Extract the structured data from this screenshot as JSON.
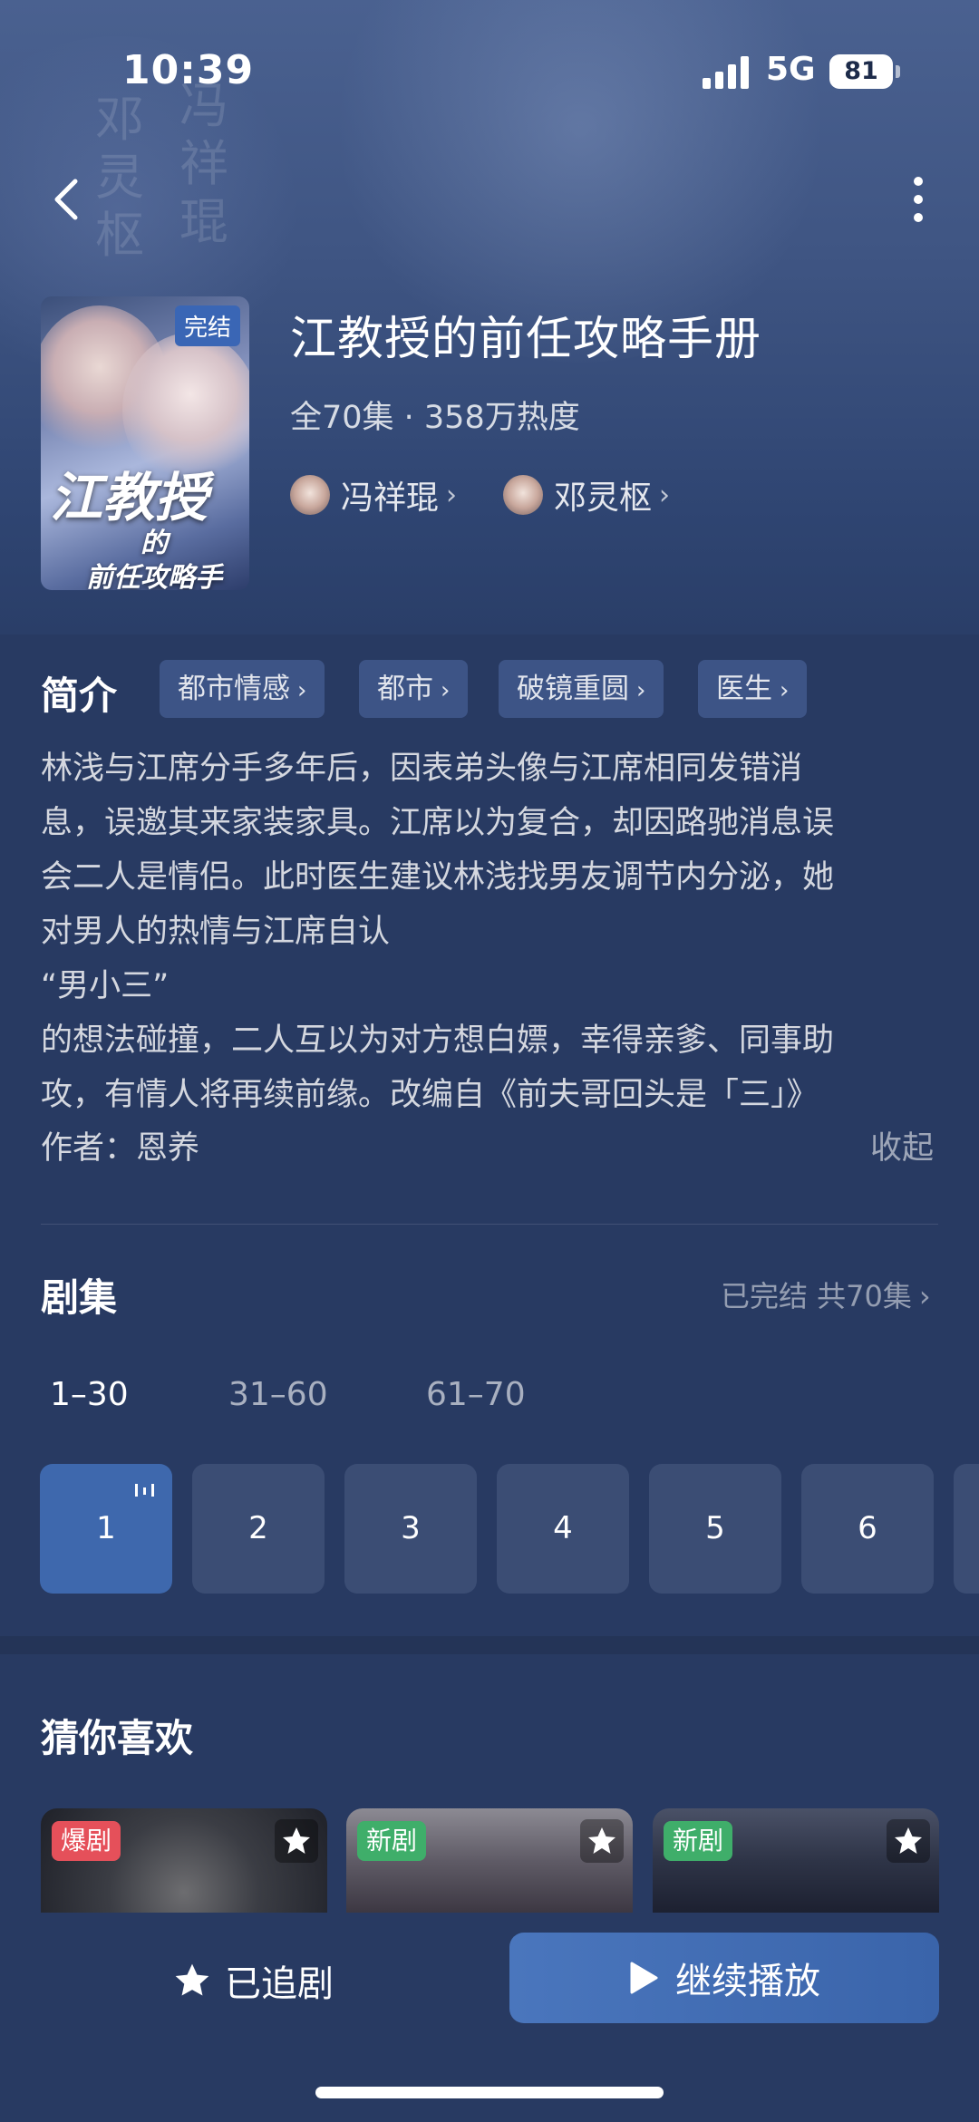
{
  "status_bar": {
    "time": "10:39",
    "network": "5G",
    "battery": "81"
  },
  "poster": {
    "badge": "完结",
    "title_big": "江教授",
    "title_de": "的",
    "title_small": "前任攻略手册"
  },
  "show": {
    "title": "江教授的前任攻略手册",
    "meta": "全70集 · 358万热度",
    "actors": [
      "冯祥琨",
      "邓灵枢"
    ]
  },
  "synopsis": {
    "label": "简介",
    "tags": [
      "都市情感",
      "都市",
      "破镜重圆",
      "医生"
    ],
    "lines": [
      "林浅与江席分手多年后，因表弟头像与江席相同发错消",
      "息，误邀其来家装家具。江席以为复合，却因路驰消息误",
      "会二人是情侣。此时医生建议林浅找男友调节内分泌，她",
      "对男人的热情与江席自认",
      "“男小三”",
      "的想法碰撞，二人互以为对方想白嫖，幸得亲爹、同事助",
      "攻，有情人将再续前缘。改编自《前夫哥回头是「三」》"
    ],
    "author": "作者：恩养",
    "collapse": "收起"
  },
  "episodes": {
    "label": "剧集",
    "status": "已完结 共70集",
    "ranges": [
      "1–30",
      "31–60",
      "61–70"
    ],
    "buttons": [
      "1",
      "2",
      "3",
      "4",
      "5",
      "6"
    ]
  },
  "recommend": {
    "label": "猜你喜欢",
    "cards": [
      {
        "badge": "爆剧",
        "badge_color": "#e5505a"
      },
      {
        "badge": "新剧",
        "badge_color": "#3fae6a"
      },
      {
        "badge": "新剧",
        "badge_color": "#3fae6a"
      }
    ]
  },
  "bottom": {
    "follow": "已追剧",
    "play": "继续播放"
  }
}
